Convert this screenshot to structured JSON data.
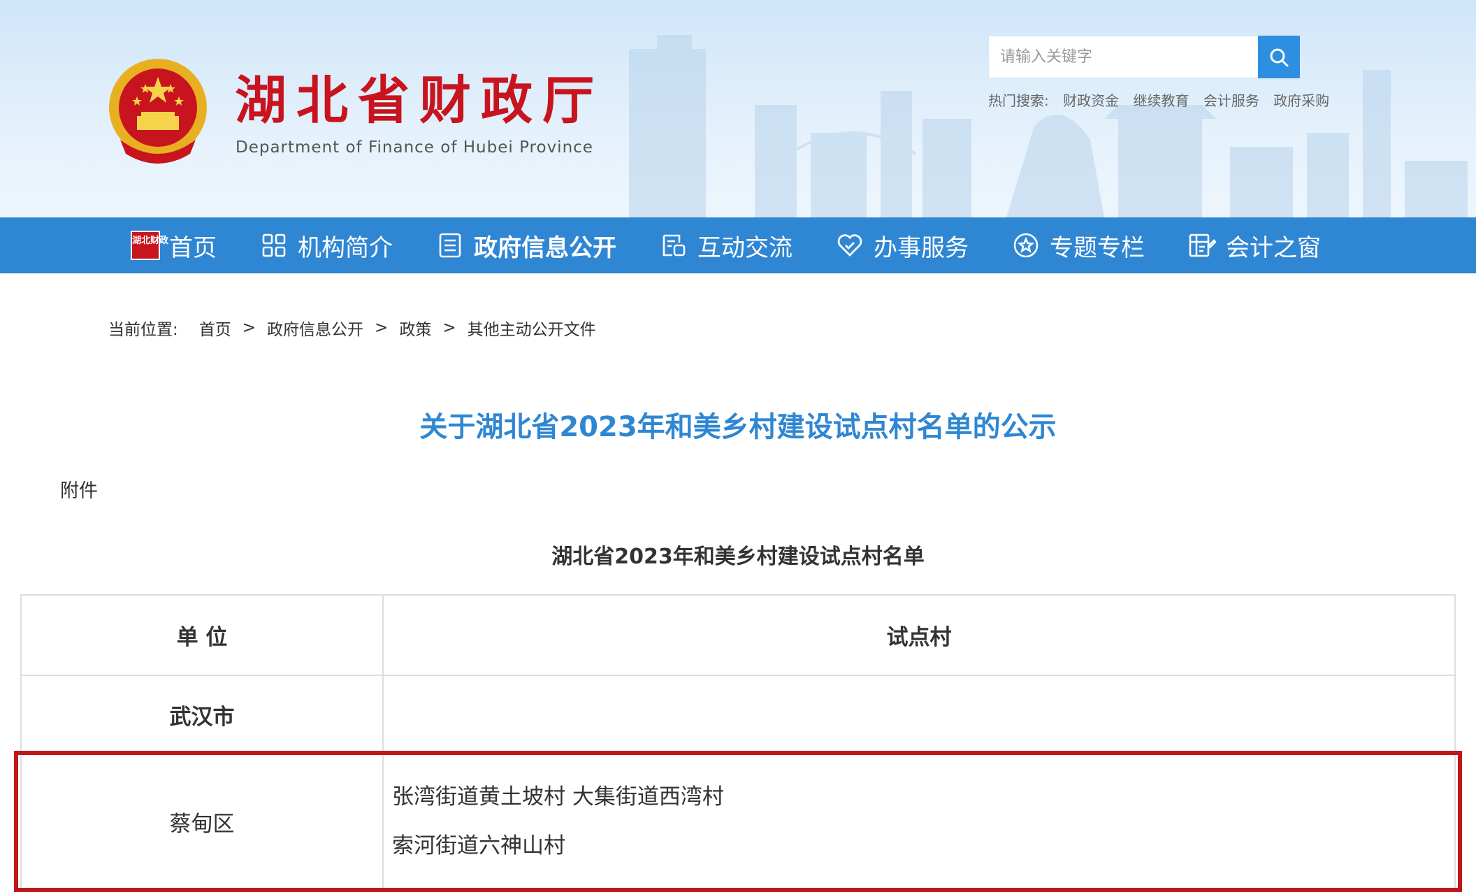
{
  "header": {
    "site_title": "湖北省财政厅",
    "site_subtitle": "Department of Finance of Hubei Province",
    "search": {
      "placeholder": "请输入关键字",
      "value": ""
    },
    "hot_search_label": "热门搜索:",
    "hot_search_links": [
      "财政资金",
      "继续教育",
      "会计服务",
      "政府采购"
    ]
  },
  "nav": {
    "items": [
      {
        "label": "首页",
        "icon": "home-badge-icon"
      },
      {
        "label": "机构简介",
        "icon": "grid-icon"
      },
      {
        "label": "政府信息公开",
        "icon": "document-icon"
      },
      {
        "label": "互动交流",
        "icon": "chat-form-icon"
      },
      {
        "label": "办事服务",
        "icon": "heart-icon"
      },
      {
        "label": "专题专栏",
        "icon": "star-circle-icon"
      },
      {
        "label": "会计之窗",
        "icon": "ledger-icon"
      }
    ],
    "home_badge_text": "湖北财政",
    "active_index": 2
  },
  "breadcrumb": {
    "lead": "当前位置:",
    "items": [
      "首页",
      "政府信息公开",
      "政策",
      "其他主动公开文件"
    ],
    "separator": ">"
  },
  "article": {
    "title": "关于湖北省2023年和美乡村建设试点村名单的公示",
    "attachment_label": "附件",
    "list_title": "湖北省2023年和美乡村建设试点村名单"
  },
  "table": {
    "headers": [
      "单 位",
      "试点村"
    ],
    "city_row": {
      "unit": "武汉市",
      "villages": ""
    },
    "district_row": {
      "unit": "蔡甸区",
      "village_lines": [
        "张湾街道黄土坡村 大集街道西湾村",
        "索河街道六神山村"
      ]
    }
  },
  "colors": {
    "nav_bg": "#2f86d3",
    "title_blue": "#2f86d3",
    "brand_red": "#c8141e",
    "highlight_red": "#c01818"
  }
}
